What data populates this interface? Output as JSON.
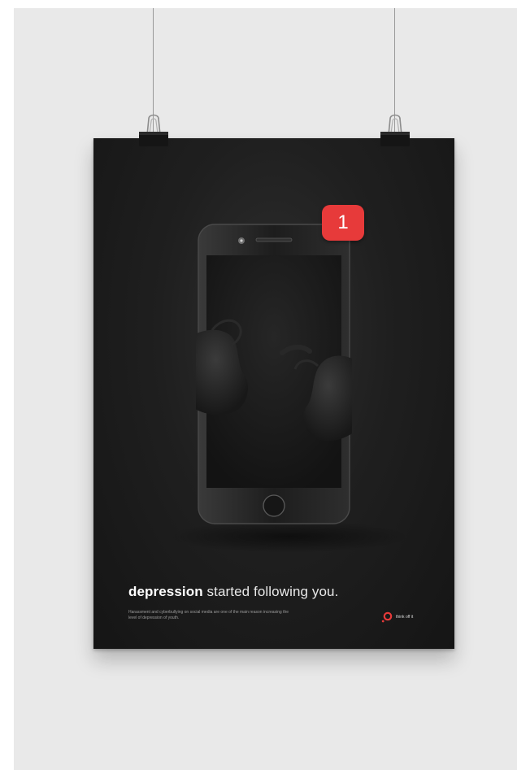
{
  "poster": {
    "notification_count": "1",
    "headline_bold": "depression",
    "headline_rest": " started following you.",
    "subtext": "Harassment and cyberbullying on social media are one of the main reason increasing the level of depression of youth.",
    "brand_name": "think off it"
  },
  "colors": {
    "wall": "#e9e9e9",
    "poster": "#1f1f1f",
    "badge": "#e73a3a",
    "logo": "#e73a3a"
  },
  "icons": {
    "clips": "binder-clip-icon",
    "logo": "ring-logo-icon"
  }
}
